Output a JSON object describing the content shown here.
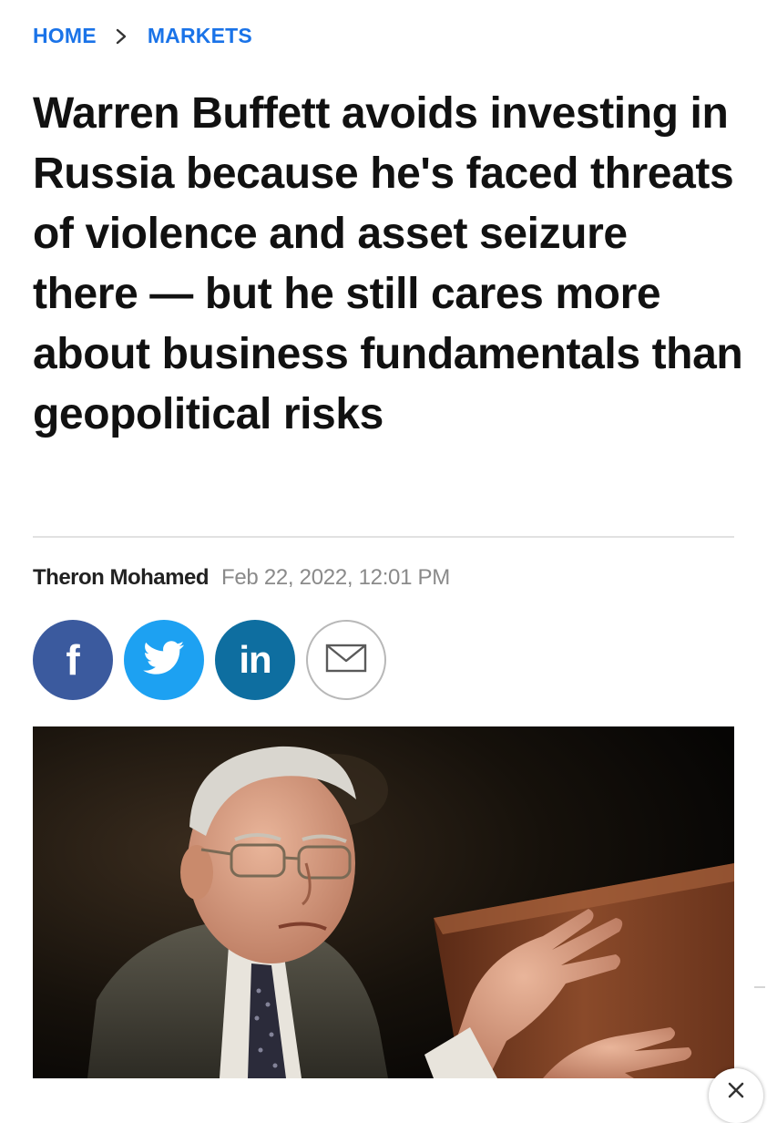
{
  "breadcrumb": {
    "home_label": "HOME",
    "section_label": "MARKETS",
    "separator_icon": "chevron-right-icon"
  },
  "article": {
    "headline": "Warren Buffett avoids investing in Russia because he's faced threats of violence and asset seizure there — but he still cares more about business fundamentals than geopolitical risks",
    "author": "Theron Mohamed",
    "published": "Feb 22, 2022, 12:01 PM"
  },
  "share": {
    "facebook": {
      "glyph": "f",
      "icon": "facebook-icon",
      "color": "#3b5a9e"
    },
    "twitter": {
      "icon": "twitter-bird-icon",
      "color": "#1da1f2"
    },
    "linkedin": {
      "glyph": "in",
      "icon": "linkedin-icon",
      "color": "#0e6ea0"
    },
    "email": {
      "icon": "envelope-icon",
      "color": "#b8b8b8"
    }
  },
  "colors": {
    "link_blue": "#1a73e8",
    "headline": "#111111",
    "timestamp": "#8a8a8a",
    "divider": "#e1e1e1"
  },
  "overlay": {
    "close_icon": "close-icon"
  }
}
